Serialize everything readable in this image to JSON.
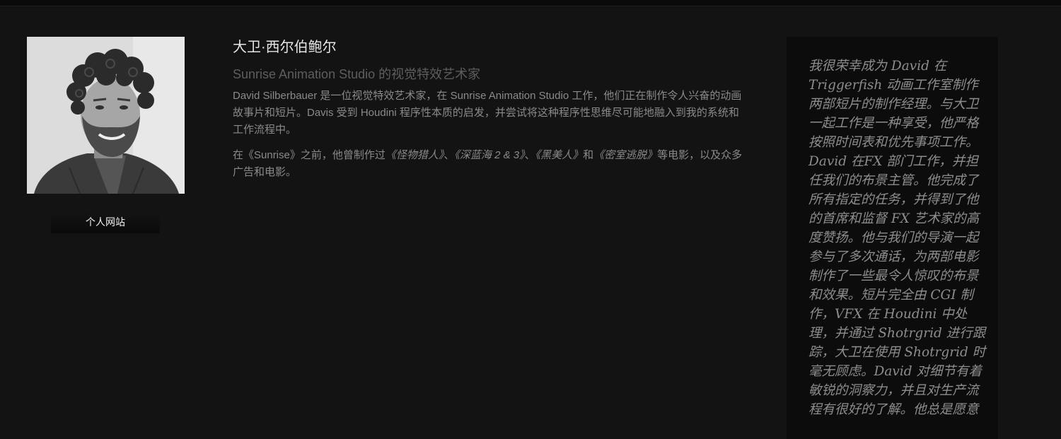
{
  "profile": {
    "name": "大卫·西尔伯鲍尔",
    "role": "Sunrise Animation Studio 的视觉特效艺术家",
    "photo_alt": "portrait-photo"
  },
  "bio": {
    "paragraph1": "David Silberbauer 是一位视觉特效艺术家，在 Sunrise Animation Studio 工作，他们正在制作令人兴奋的动画故事片和短片。Davis 受到 Houdini 程序性本质的启发，并尝试将这种程序性思维尽可能地融入到我的系统和工作流程中。",
    "paragraph2": {
      "before": "在《Sunrise》之前，他曾制作过",
      "film1": "《怪物猎人》",
      "sep1": "、",
      "film2": "《深蓝海 2 & 3》",
      "sep2": "、",
      "film3": "《黑美人》",
      "conj": "和",
      "film4": "《密室逃脱》",
      "after": "等电影，以及众多广告和电影。"
    }
  },
  "actions": {
    "website_label": "个人网站"
  },
  "testimonial": {
    "text": "我很荣幸成为 David 在 Triggerfish 动画工作室制作两部短片的制作经理。与大卫一起工作是一种享受，他严格按照时间表和优先事项工作。David 在FX 部门工作，并担任我们的布景主管。他完成了所有指定的任务，并得到了他的首席和监督 FX 艺术家的高度赞扬。他与我们的导演一起参与了多次通话，为两部电影制作了一些最令人惊叹的布景和效果。短片完全由 CGI 制作，VFX 在 Houdini 中处理，并通过 Shotrgrid 进行跟踪，大卫在使用 Shotrgrid 时毫无顾虑。David 对细节有着敏锐的洞察力，并且对生产流程有很好的了解。他总是愿意"
  }
}
